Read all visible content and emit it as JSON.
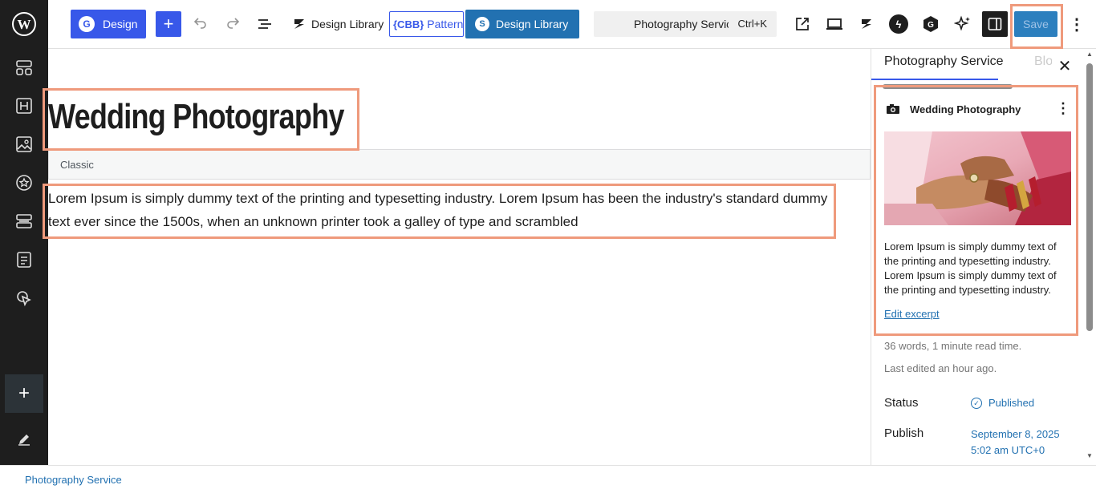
{
  "toolbar": {
    "design_label": "Design",
    "design_library_label": "Design Library",
    "cbb_badge": "{CBB}",
    "pattern_label": "Pattern",
    "design_library2_label": "Design Library",
    "command_title": "Photography Service",
    "command_shortcut": "Ctrl+K",
    "save_label": "Save"
  },
  "sidebar_icons": [
    "wordpress-logo",
    "layout-icon",
    "heading-icon",
    "image-icon",
    "star-badge-icon",
    "blocks-icon",
    "form-icon",
    "pointer-icon",
    "plus-icon",
    "pencil-icon"
  ],
  "editor": {
    "title": "Wedding Photography",
    "classic_label": "Classic",
    "paragraph": "Lorem Ipsum is simply dummy text of the printing and typesetting industry. Lorem Ipsum has been the industry's standard dummy text ever since the 1500s, when an unknown printer took a galley of type and scrambled"
  },
  "panel": {
    "tab_active": "Photography Service",
    "tab_other": "Block",
    "card_title": "Wedding Photography",
    "excerpt": "Lorem Ipsum is simply dummy text of the printing and typesetting industry. Lorem Ipsum is simply dummy text of the printing and typesetting industry.",
    "edit_excerpt": "Edit excerpt",
    "word_count": "36 words, 1 minute read time.",
    "last_edited": "Last edited an hour ago.",
    "status_label": "Status",
    "status_value": "Published",
    "publish_label": "Publish",
    "publish_value": "September 8, 2025 5:02 am UTC+0"
  },
  "footer": {
    "breadcrumb": "Photography Service"
  },
  "colors": {
    "wp_blue": "#3858e9",
    "admin_blue": "#2271b1",
    "dark": "#1e1e1e",
    "highlight": "#ef9a7c"
  }
}
